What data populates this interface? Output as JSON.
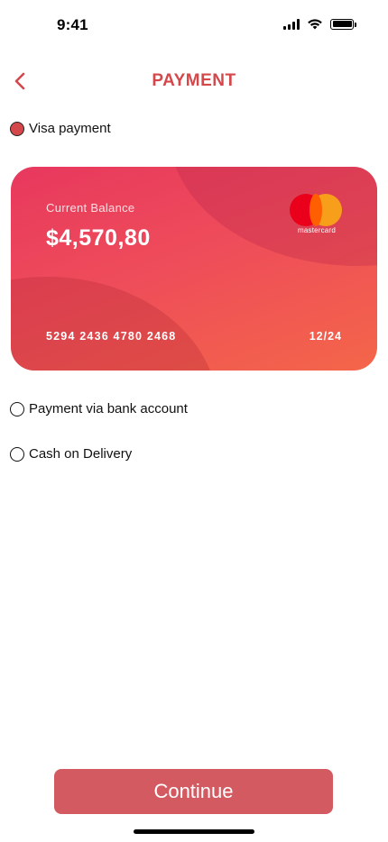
{
  "status_bar": {
    "time": "9:41",
    "icons": [
      "signal-icon",
      "wifi-icon",
      "battery-icon"
    ]
  },
  "header": {
    "back_icon": "chevron-left-icon",
    "title": "PAYMENT"
  },
  "payment_options": [
    {
      "label": "Visa payment",
      "selected": true
    },
    {
      "label": "Payment via bank account",
      "selected": false
    },
    {
      "label": "Cash on Delivery",
      "selected": false
    }
  ],
  "card": {
    "balance_label": "Current Balance",
    "balance": "$4,570,80",
    "brand": "mastercard",
    "number": "5294 2436 4780 2468",
    "expiry": "12/24"
  },
  "continue_button": {
    "label": "Continue"
  },
  "colors": {
    "accent": "#D4484C",
    "button": "#D45A62",
    "card_gradient_start": "#E8385E",
    "card_gradient_end": "#F46649"
  }
}
